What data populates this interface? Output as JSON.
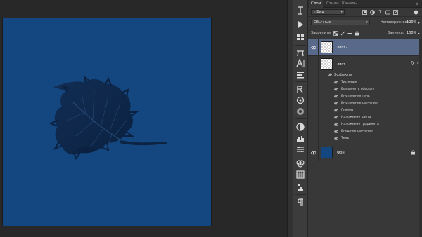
{
  "panel": {
    "tabs": [
      "Слои",
      "Стили",
      "Каналы"
    ],
    "active_tab": 0,
    "menu_icon": "panel-menu-icon",
    "filter": {
      "label": "Вид",
      "caret": "▾"
    },
    "blend_mode": {
      "value": "Обычные",
      "caret": "▾"
    },
    "opacity": {
      "label": "Непрозрачность:",
      "value": "100%"
    },
    "lock": {
      "label": "Закрепить:"
    },
    "fill": {
      "label": "Заливка:",
      "value": "100%"
    }
  },
  "layers": [
    {
      "name": "лист2",
      "selected": true,
      "visible": true,
      "thumb": "checker"
    },
    {
      "name": "лист",
      "selected": false,
      "visible": false,
      "thumb": "checker",
      "fx": "fx",
      "effects_title": "Эффекты",
      "effects": [
        "Тиснение",
        "Выполнить обводку",
        "Внутренняя тень",
        "Внутреннее свечение",
        "Глянец",
        "Наложение цвета",
        "Наложение градиента",
        "Внешнее свечение",
        "Тень"
      ]
    },
    {
      "name": "Фон",
      "selected": false,
      "visible": true,
      "thumb": "blue",
      "thumb_color": "#144680",
      "locked": true
    }
  ],
  "colors": {
    "document_fill": "#144680",
    "leaf": "#0d2748",
    "selected_layer": "#59698a",
    "panel_bg": "#383838"
  },
  "tools": [
    "history-brush-icon",
    "play-icon",
    "swatches-icon",
    "brush-presets-icon",
    "type-icon",
    "paragraph-styles-icon",
    "character-icon",
    "properties-icon",
    "info-icon",
    "adjustments-icon",
    "histogram-icon",
    "layer-comps-icon",
    "clone-source-icon",
    "tool-presets-icon",
    "notes-icon",
    "pilcrow-icon"
  ]
}
